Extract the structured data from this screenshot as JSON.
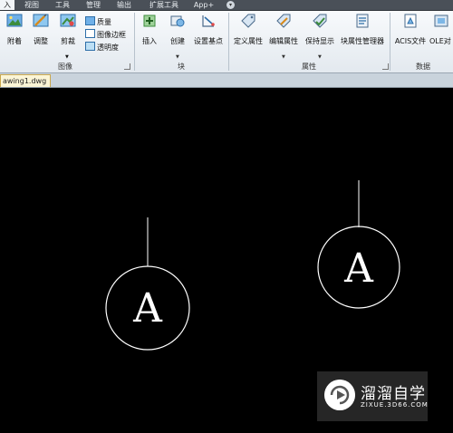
{
  "menubar": {
    "tabs": [
      {
        "label": "入",
        "active": true
      },
      {
        "label": "视图"
      },
      {
        "label": "工具"
      },
      {
        "label": "管理"
      },
      {
        "label": "输出"
      },
      {
        "label": "扩展工具"
      },
      {
        "label": "App+"
      }
    ],
    "caret_glyph": "▾"
  },
  "ribbon": {
    "image_group": {
      "title": "图像",
      "attach": "附着",
      "adjust": "调整",
      "clip": "剪裁",
      "quality": "质量",
      "frame": "图像边框",
      "transparency": "透明度"
    },
    "block_group": {
      "title": "块",
      "insert": "插入",
      "create": "创建",
      "set_base": "设置基点"
    },
    "attr_group": {
      "title": "属性",
      "define": "定义属性",
      "edit": "编辑属性",
      "keep_display": "保持显示",
      "manager": "块属性管理器"
    },
    "data_group": {
      "title": "数据",
      "acis": "ACIS文件",
      "ole": "OLE对"
    }
  },
  "document": {
    "tab_label": "awing1.dwg"
  },
  "drawing": {
    "label_left": "A",
    "label_right": "A"
  },
  "watermark": {
    "title": "溜溜自学",
    "url": "ZIXUE.3D66.COM"
  },
  "colors": {
    "canvas": "#000000",
    "entity": "#ffffff",
    "doc_tab": "#fbf5d6"
  }
}
